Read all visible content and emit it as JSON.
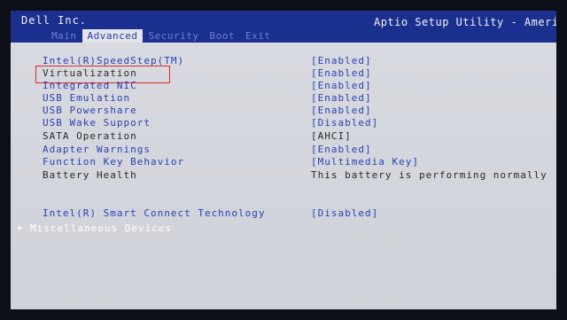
{
  "header": {
    "vendor": "Dell Inc.",
    "app_title": "Aptio Setup Utility - America"
  },
  "tabs": [
    {
      "label": "Main",
      "active": false
    },
    {
      "label": "Advanced",
      "active": true
    },
    {
      "label": "Security",
      "active": false
    },
    {
      "label": "Boot",
      "active": false
    },
    {
      "label": "Exit",
      "active": false
    }
  ],
  "settings": [
    {
      "label": "Intel(R)SpeedStep(TM)",
      "value": "[Enabled]"
    },
    {
      "label": "Virtualization",
      "value": "[Enabled]"
    },
    {
      "label": "Integrated NIC",
      "value": "[Enabled]"
    },
    {
      "label": "USB Emulation",
      "value": "[Enabled]"
    },
    {
      "label": "USB Powershare",
      "value": "[Enabled]"
    },
    {
      "label": "USB Wake Support",
      "value": "[Disabled]"
    },
    {
      "label": "SATA Operation",
      "value": "[AHCI]"
    },
    {
      "label": "Adapter Warnings",
      "value": "[Enabled]"
    },
    {
      "label": "Function Key Behavior",
      "value": "[Multimedia Key]"
    },
    {
      "label": "Battery Health",
      "value": "This battery is performing normally"
    }
  ],
  "smart_connect": {
    "label": "Intel(R) Smart Connect Technology",
    "value": "[Disabled]"
  },
  "misc_devices": {
    "label": "Miscellaneous Devices",
    "arrow": "▶"
  }
}
